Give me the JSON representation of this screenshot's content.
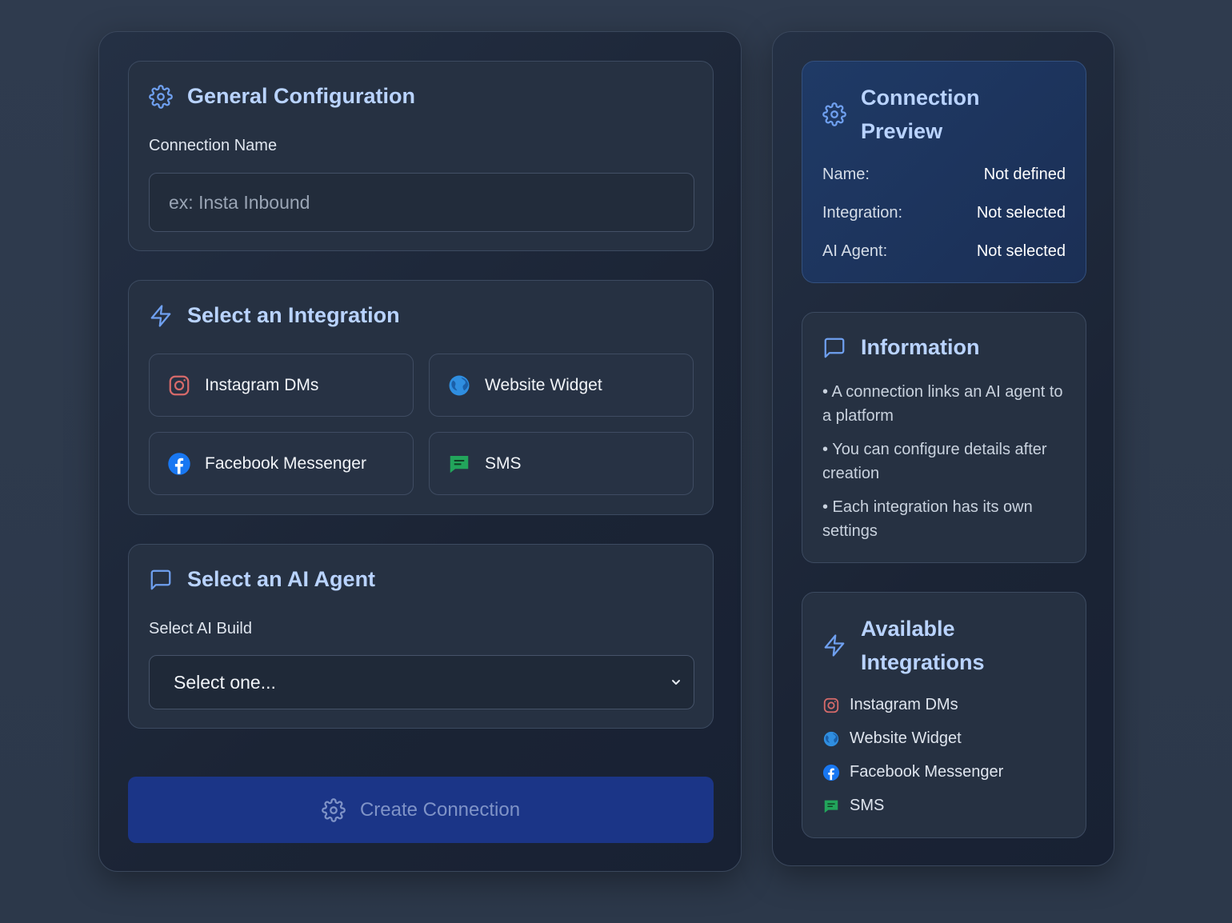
{
  "general": {
    "title": "General Configuration",
    "connection_name_label": "Connection Name",
    "connection_name_value": "",
    "connection_name_placeholder": "ex: Insta Inbound"
  },
  "integration": {
    "title": "Select an Integration",
    "options": [
      {
        "label": "Instagram DMs",
        "icon": "instagram-icon"
      },
      {
        "label": "Website Widget",
        "icon": "globe-icon"
      },
      {
        "label": "Facebook Messenger",
        "icon": "facebook-icon"
      },
      {
        "label": "SMS",
        "icon": "sms-icon"
      }
    ]
  },
  "agent": {
    "title": "Select an AI Agent",
    "build_label": "Select AI Build",
    "selected": "Select one..."
  },
  "create_button": {
    "label": "Create Connection"
  },
  "preview": {
    "title_line1": "Connection",
    "title_line2": "Preview",
    "rows": [
      {
        "key": "Name:",
        "value": "Not defined"
      },
      {
        "key": "Integration:",
        "value": "Not selected"
      },
      {
        "key": "AI Agent:",
        "value": "Not selected"
      }
    ]
  },
  "information": {
    "title": "Information",
    "items": [
      "• A connection links an AI agent to a platform",
      "• You can configure details after creation",
      "• Each integration has its own settings"
    ]
  },
  "available": {
    "title_line1": "Available",
    "title_line2": "Integrations",
    "items": [
      "Instagram DMs",
      "Website Widget",
      "Facebook Messenger",
      "SMS"
    ]
  },
  "colors": {
    "accent": "#6fa0f0",
    "instagram": "#d66a6a",
    "globe": "#2f8ee0",
    "facebook": "#1877f2",
    "sms": "#22a55b",
    "create_button_bg": "#1b3587"
  }
}
